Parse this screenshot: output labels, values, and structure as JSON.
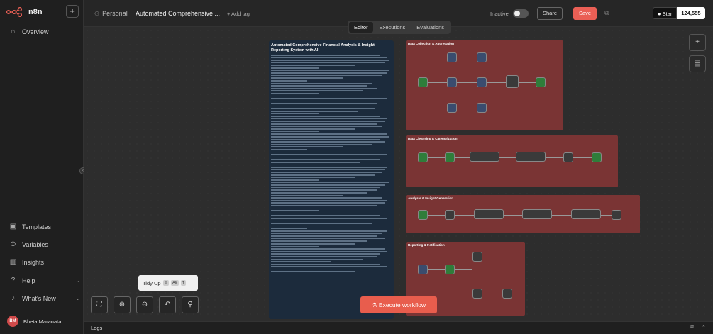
{
  "brand": {
    "name": "n8n"
  },
  "sidebar": {
    "add_label": "+",
    "overview": "Overview",
    "items": [
      {
        "label": "Templates",
        "icon": "box-icon"
      },
      {
        "label": "Variables",
        "icon": "variable-icon"
      },
      {
        "label": "Insights",
        "icon": "chart-icon"
      },
      {
        "label": "Help",
        "icon": "help-icon"
      },
      {
        "label": "What's New",
        "icon": "bell-icon"
      }
    ],
    "user": {
      "initials": "BM",
      "name": "Bheta Maranata"
    }
  },
  "header": {
    "project": "Personal",
    "separator": "/",
    "workflow_title": "Automated Comprehensive ...",
    "add_tag": "+ Add tag",
    "status": "Inactive",
    "share": "Share",
    "save": "Save",
    "github": {
      "label": "Star",
      "count": "124,555"
    }
  },
  "tabs": [
    {
      "label": "Editor",
      "active": true
    },
    {
      "label": "Executions",
      "active": false
    },
    {
      "label": "Evaluations",
      "active": false
    }
  ],
  "sticky": {
    "title": "Automated Comprehensive Financial Analysis & Insight Reporting System with AI"
  },
  "groups": [
    {
      "label": "Data Collection & Aggregation"
    },
    {
      "label": "Data Cleansing & Categorization"
    },
    {
      "label": "Analysis & Insight Generation"
    },
    {
      "label": "Reporting & Notification"
    }
  ],
  "toolbar": {
    "tidy_up": "Tidy Up",
    "tidy_keys": [
      "⇧",
      "Alt",
      "T"
    ],
    "execute": "Execute workflow"
  },
  "logs": {
    "label": "Logs"
  },
  "colors": {
    "accent": "#ea5f55",
    "group": "#7a3434",
    "sticky": "#1c2b3c"
  }
}
